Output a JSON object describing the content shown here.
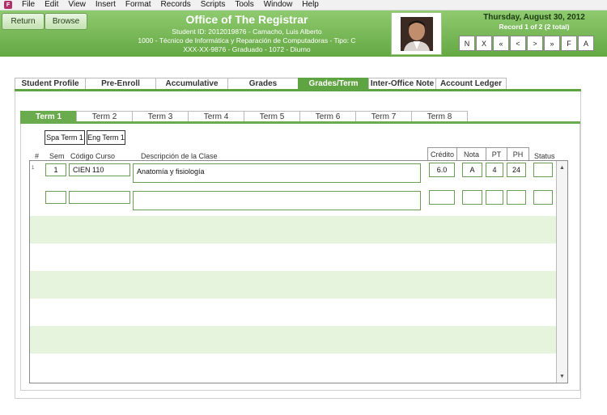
{
  "menu": [
    "File",
    "Edit",
    "View",
    "Insert",
    "Format",
    "Records",
    "Scripts",
    "Tools",
    "Window",
    "Help"
  ],
  "header": {
    "return_label": "Return",
    "browse_label": "Browse",
    "title": "Office of The Registrar",
    "student_line": "Student ID: 2012019876 - Camacho, Luis Alberto",
    "program_line": "1000 - Técnico de Informática y Reparación de Computadoras - Tipo: C",
    "status_line": "XXX-XX-9876 - Graduado - 1072 - Diurno",
    "date": "Thursday, August 30, 2012",
    "record_info": "Record 1 of 2 (2 total)",
    "nav_buttons": [
      "N",
      "X",
      "«",
      "<",
      ">",
      "»",
      "F",
      "A"
    ]
  },
  "main_tabs": [
    "Student Profile",
    "Pre-Enroll",
    "Accumulative",
    "Grades",
    "Grades/Term",
    "Inter-Office Note",
    "Account Ledger"
  ],
  "active_main_tab": "Grades/Term",
  "term_tabs": [
    "Term 1",
    "Term 2",
    "Term 3",
    "Term 4",
    "Term 5",
    "Term 6",
    "Term 7",
    "Term 8"
  ],
  "active_term_tab": "Term 1",
  "language_buttons": {
    "spanish": "Spa Term 1",
    "english": "Eng Term 1"
  },
  "columns": {
    "num": "#",
    "sem": "Sem",
    "code": "Código Curso",
    "desc": "Descripción de la Clase",
    "credit": "Crédito",
    "grade": "Nota",
    "pt": "PT",
    "ph": "PH",
    "status": "Status"
  },
  "rows": [
    {
      "num": "1",
      "sem": "1",
      "code": "CIEN 110",
      "desc": "Anatomía y fisiología",
      "credit": "6.0",
      "grade": "A",
      "pt": "4",
      "ph": "24",
      "status": ""
    },
    {
      "num": "",
      "sem": "",
      "code": "",
      "desc": "",
      "credit": "",
      "grade": "",
      "pt": "",
      "ph": "",
      "status": ""
    }
  ],
  "colors": {
    "header_green": "#64a843",
    "tab_active": "#5fa443",
    "row_alt": "#e6f3dd"
  }
}
